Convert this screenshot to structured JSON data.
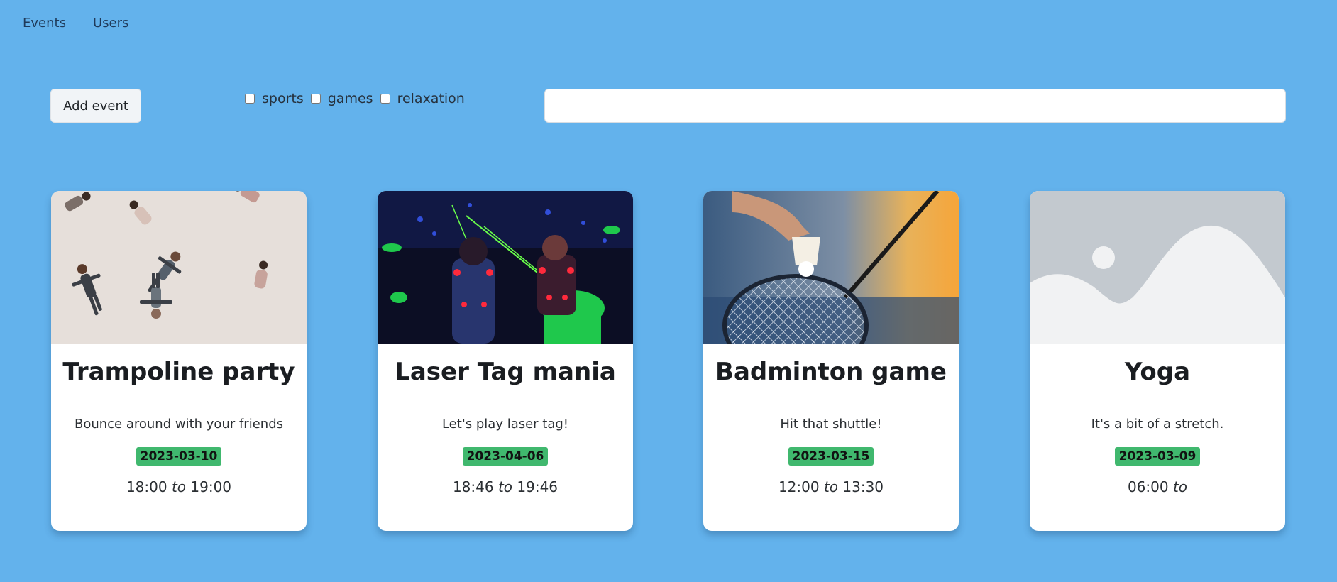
{
  "nav": {
    "events": "Events",
    "users": "Users"
  },
  "toolbar": {
    "add_event_label": "Add event",
    "filters": [
      {
        "label": "sports",
        "checked": false
      },
      {
        "label": "games",
        "checked": false
      },
      {
        "label": "relaxation",
        "checked": false
      }
    ],
    "search_value": "",
    "search_placeholder": ""
  },
  "connector": "to",
  "cards": [
    {
      "title": "Trampoline party",
      "description": "Bounce around with your friends",
      "date": "2023-03-10",
      "start": "18:00",
      "end": "19:00",
      "image": "people-falling"
    },
    {
      "title": "Laser Tag mania",
      "description": "Let's play laser tag!",
      "date": "2023-04-06",
      "start": "18:46",
      "end": "19:46",
      "image": "laser-tag"
    },
    {
      "title": "Badminton game",
      "description": "Hit that shuttle!",
      "date": "2023-03-15",
      "start": "12:00",
      "end": "13:30",
      "image": "badminton"
    },
    {
      "title": "Yoga",
      "description": "It's a bit of a stretch.",
      "date": "2023-03-09",
      "start": "06:00",
      "end": "",
      "image": "placeholder"
    }
  ],
  "colors": {
    "background": "#63b2ec",
    "badge": "#40b86e"
  }
}
